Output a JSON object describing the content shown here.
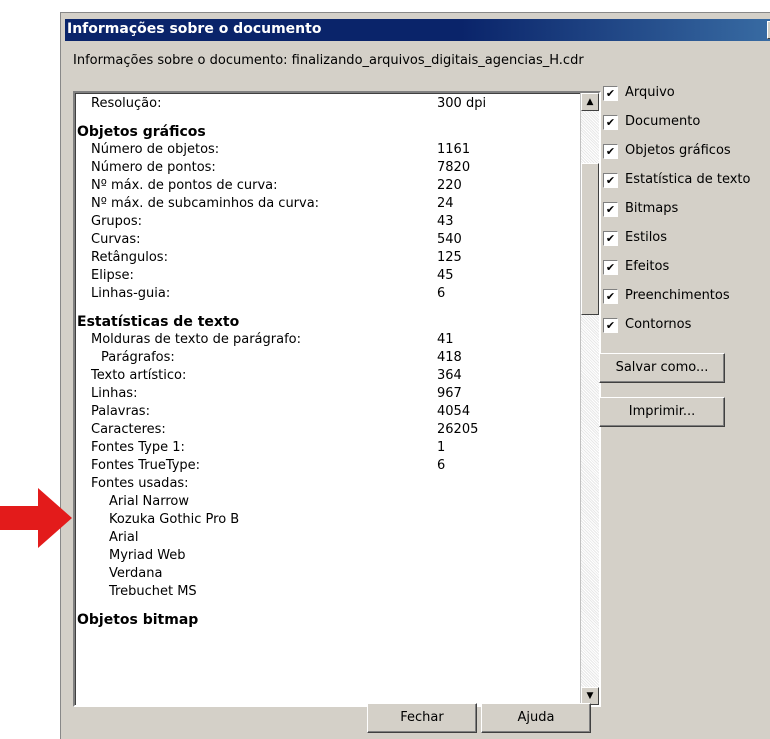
{
  "window": {
    "title": "Informações sobre o documento",
    "close_label": "X"
  },
  "file_line": "Informações sobre o documento: finalizando_arquivos_digitais_agencias_H.cdr",
  "rows": [
    {
      "type": "item",
      "label": "Resolução:",
      "value": "300 dpi"
    },
    {
      "type": "head",
      "label": "Objetos gráficos"
    },
    {
      "type": "item",
      "label": "Número de objetos:",
      "value": "1161"
    },
    {
      "type": "item",
      "label": "Número de pontos:",
      "value": "7820"
    },
    {
      "type": "item",
      "label": "Nº máx. de pontos de curva:",
      "value": "220"
    },
    {
      "type": "item",
      "label": "Nº máx. de subcaminhos da curva:",
      "value": "24"
    },
    {
      "type": "item",
      "label": "Grupos:",
      "value": "43"
    },
    {
      "type": "item",
      "label": "Curvas:",
      "value": "540"
    },
    {
      "type": "item",
      "label": "Retângulos:",
      "value": "125"
    },
    {
      "type": "item",
      "label": "Elipse:",
      "value": "45"
    },
    {
      "type": "item",
      "label": "Linhas-guia:",
      "value": "6"
    },
    {
      "type": "head",
      "label": "Estatísticas de texto"
    },
    {
      "type": "item",
      "label": "Molduras de texto de parágrafo:",
      "value": "41"
    },
    {
      "type": "sub",
      "label": "Parágrafos:",
      "value": "418"
    },
    {
      "type": "item",
      "label": "Texto artístico:",
      "value": "364"
    },
    {
      "type": "item",
      "label": "Linhas:",
      "value": "967"
    },
    {
      "type": "item",
      "label": "Palavras:",
      "value": "4054"
    },
    {
      "type": "item",
      "label": "Caracteres:",
      "value": "26205"
    },
    {
      "type": "item",
      "label": "Fontes Type 1:",
      "value": "1"
    },
    {
      "type": "item",
      "label": "Fontes TrueType:",
      "value": "6"
    },
    {
      "type": "item",
      "label": "Fontes usadas:",
      "value": ""
    },
    {
      "type": "font",
      "label": "Arial Narrow"
    },
    {
      "type": "font",
      "label": "Kozuka Gothic Pro B"
    },
    {
      "type": "font",
      "label": "Arial"
    },
    {
      "type": "font",
      "label": "Myriad Web"
    },
    {
      "type": "font",
      "label": "Verdana"
    },
    {
      "type": "font",
      "label": "Trebuchet MS"
    },
    {
      "type": "head",
      "label": "Objetos bitmap"
    }
  ],
  "checkboxes": [
    {
      "label": "Arquivo",
      "checked": true
    },
    {
      "label": "Documento",
      "checked": true
    },
    {
      "label": "Objetos gráficos",
      "checked": true
    },
    {
      "label": "Estatística de texto",
      "checked": true
    },
    {
      "label": "Bitmaps",
      "checked": true
    },
    {
      "label": "Estilos",
      "checked": true
    },
    {
      "label": "Efeitos",
      "checked": true
    },
    {
      "label": "Preenchimentos",
      "checked": true
    },
    {
      "label": "Contornos",
      "checked": true
    }
  ],
  "buttons": {
    "save_as": "Salvar como...",
    "print": "Imprimir...",
    "close": "Fechar",
    "help": "Ajuda"
  },
  "colors": {
    "arrow": "#e31b1b",
    "titlebar": "#0a246a"
  }
}
